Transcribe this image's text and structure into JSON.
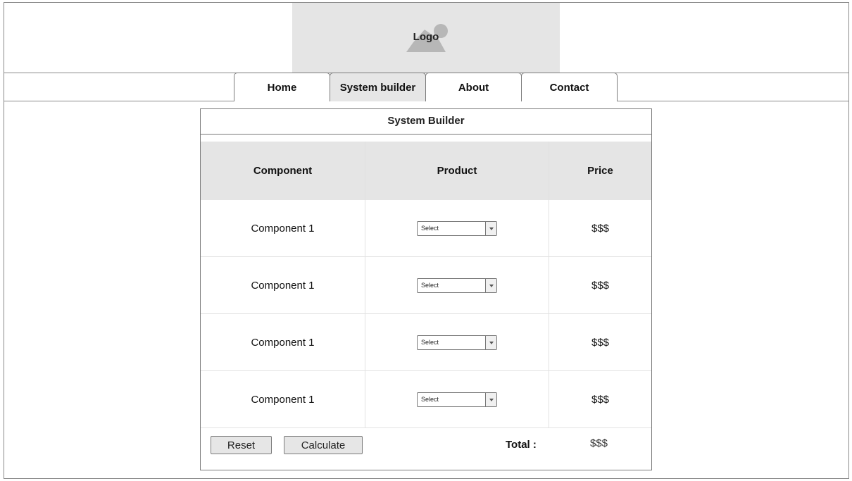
{
  "header": {
    "logo_label": "Logo"
  },
  "nav": {
    "tabs": [
      {
        "label": "Home"
      },
      {
        "label": "System builder",
        "active": true
      },
      {
        "label": "About"
      },
      {
        "label": "Contact"
      }
    ]
  },
  "panel": {
    "title": "System Builder",
    "columns": [
      "Component",
      "Product",
      "Price"
    ],
    "rows": [
      {
        "component": "Component 1",
        "product": "Select",
        "price": "$$$"
      },
      {
        "component": "Component 1",
        "product": "Select",
        "price": "$$$"
      },
      {
        "component": "Component 1",
        "product": "Select",
        "price": "$$$"
      },
      {
        "component": "Component 1",
        "product": "Select",
        "price": "$$$"
      }
    ],
    "reset_label": "Reset",
    "calculate_label": "Calculate",
    "total_label": "Total :",
    "total_value": "$$$"
  },
  "colors": {
    "header_fill": "#e5e5e5",
    "active_tab": "#e6e6e6",
    "border": "#7a7a7a"
  }
}
